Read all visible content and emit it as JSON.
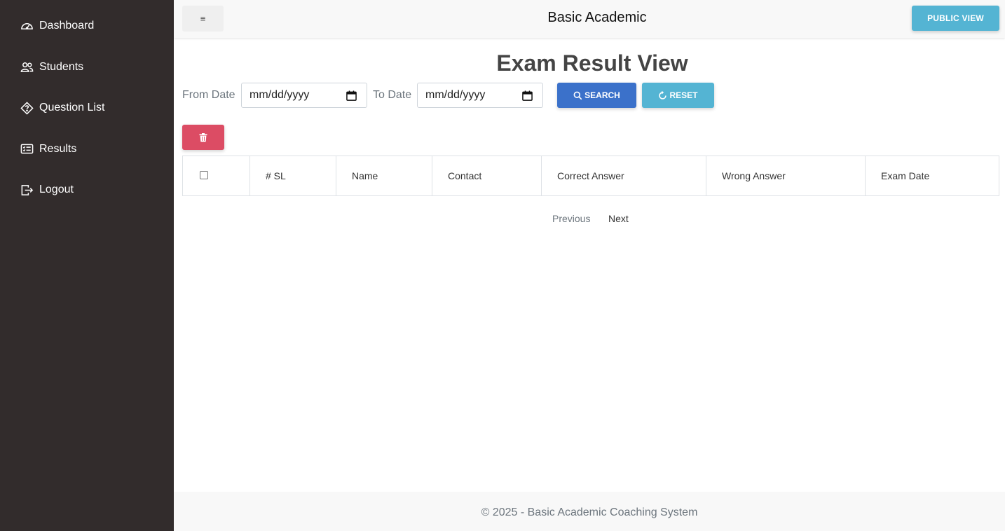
{
  "sidebar": {
    "items": [
      {
        "label": "Dashboard",
        "icon": "speedometer-icon"
      },
      {
        "label": "Students",
        "icon": "people-icon"
      },
      {
        "label": "Question List",
        "icon": "question-diamond-icon"
      },
      {
        "label": "Results",
        "icon": "card-checklist-icon"
      },
      {
        "label": "Logout",
        "icon": "box-arrow-right-icon"
      }
    ]
  },
  "topbar": {
    "menu_icon": "≡",
    "brand": "Basic Academic",
    "public_view_label": "PUBLIC VIEW"
  },
  "main": {
    "title": "Exam Result View",
    "filter": {
      "from_label": "From Date",
      "from_placeholder": "mm/dd/yyyy",
      "to_label": "To Date",
      "to_placeholder": "mm/dd/yyyy",
      "search_label": "SEARCH",
      "reset_label": "RESET"
    },
    "table": {
      "headers": [
        "# SL",
        "Name",
        "Contact",
        "Correct Answer",
        "Wrong Answer",
        "Exam Date"
      ],
      "rows": []
    },
    "pagination": {
      "previous": "Previous",
      "next": "Next"
    }
  },
  "footer": {
    "text": "© 2025 - Basic Academic Coaching System"
  },
  "colors": {
    "sidebar_bg": "#322c2c",
    "primary": "#3b71ca",
    "info": "#54b4d3",
    "danger": "#dc4c64"
  }
}
